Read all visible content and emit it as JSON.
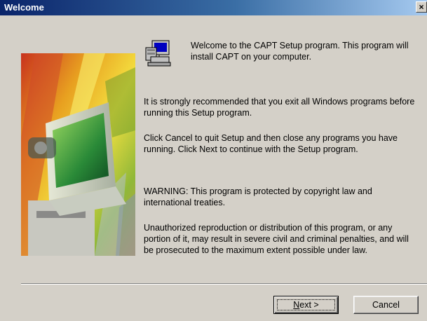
{
  "window": {
    "title": "Welcome",
    "close_glyph": "×"
  },
  "content": {
    "welcome": "Welcome to the CAPT Setup program.  This program will install CAPT on your computer.",
    "recommend": "It is strongly recommended that you exit all Windows programs before running this Setup program.",
    "instructions": "Click Cancel to quit Setup and then close any programs you have running.  Click Next to continue with the Setup program.",
    "warning": "WARNING: This program is protected by copyright law and international treaties.",
    "unauthorized": "Unauthorized reproduction or distribution of this program, or any portion of it, may result in severe civil and criminal penalties, and will be prosecuted to the maximum extent possible under law."
  },
  "buttons": {
    "next_mnemonic": "N",
    "next_rest": "ext >",
    "cancel": "Cancel"
  },
  "icons": {
    "setup": "setup-computer-icon",
    "artwork": "computer-artwork"
  },
  "colors": {
    "title_start": "#0a246a",
    "title_end": "#a6caf0",
    "face": "#d4d0c8"
  }
}
